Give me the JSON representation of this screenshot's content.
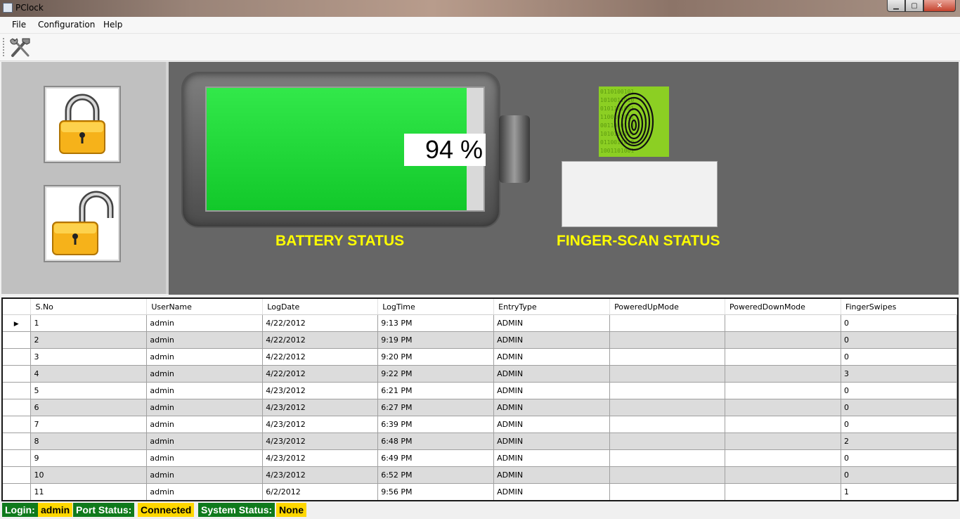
{
  "window": {
    "title": "PClock",
    "min": "▁",
    "max": "▢",
    "close": "✕"
  },
  "menu": {
    "items": [
      "File",
      "Configuration",
      "Help"
    ]
  },
  "colors": {
    "statusLabelBg": "#0f7a1c",
    "statusValueBg": "#ffd700",
    "batteryFill": "#22d83a",
    "panelBg": "#666666"
  },
  "battery": {
    "percent_text": "94 %",
    "level": 0.94,
    "label": "BATTERY STATUS"
  },
  "finger": {
    "label": "FINGER-SCAN STATUS",
    "status_text": ""
  },
  "grid": {
    "row_marker": "▶",
    "columns": [
      "S.No",
      "UserName",
      "LogDate",
      "LogTime",
      "EntryType",
      "PoweredUpMode",
      "PoweredDownMode",
      "FingerSwipes"
    ],
    "rows": [
      [
        "1",
        "admin",
        "4/22/2012",
        "9:13 PM",
        "ADMIN",
        "",
        "",
        "0"
      ],
      [
        "2",
        "admin",
        "4/22/2012",
        "9:19 PM",
        "ADMIN",
        "",
        "",
        "0"
      ],
      [
        "3",
        "admin",
        "4/22/2012",
        "9:20 PM",
        "ADMIN",
        "",
        "",
        "0"
      ],
      [
        "4",
        "admin",
        "4/22/2012",
        "9:22 PM",
        "ADMIN",
        "",
        "",
        "3"
      ],
      [
        "5",
        "admin",
        "4/23/2012",
        "6:21 PM",
        "ADMIN",
        "",
        "",
        "0"
      ],
      [
        "6",
        "admin",
        "4/23/2012",
        "6:27 PM",
        "ADMIN",
        "",
        "",
        "0"
      ],
      [
        "7",
        "admin",
        "4/23/2012",
        "6:39 PM",
        "ADMIN",
        "",
        "",
        "0"
      ],
      [
        "8",
        "admin",
        "4/23/2012",
        "6:48 PM",
        "ADMIN",
        "",
        "",
        "2"
      ],
      [
        "9",
        "admin",
        "4/23/2012",
        "6:49 PM",
        "ADMIN",
        "",
        "",
        "0"
      ],
      [
        "10",
        "admin",
        "4/23/2012",
        "6:52 PM",
        "ADMIN",
        "",
        "",
        "0"
      ],
      [
        "11",
        "admin",
        "6/2/2012",
        "9:56 PM",
        "ADMIN",
        "",
        "",
        "1"
      ]
    ]
  },
  "status": {
    "login_label": "Login:",
    "login_value": "admin",
    "port_label": "Port Status:",
    "port_value": "Connected",
    "system_label": "System Status:",
    "system_value": "None"
  }
}
